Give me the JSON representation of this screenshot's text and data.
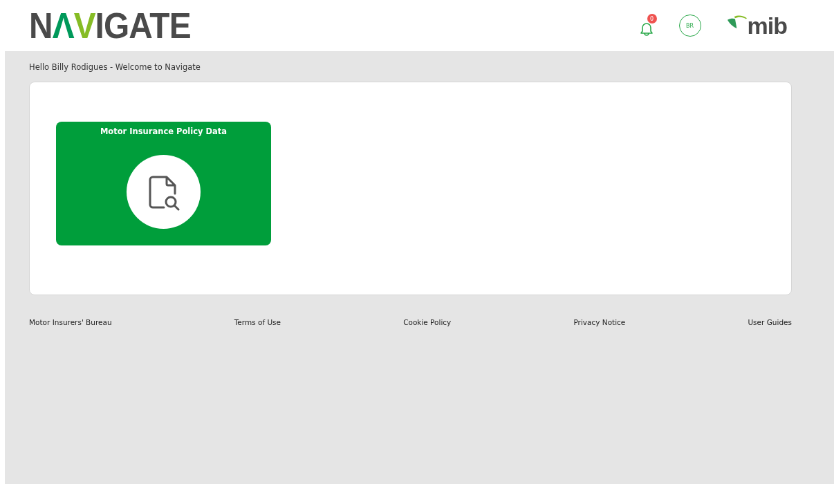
{
  "header": {
    "logo": [
      {
        "text": "N",
        "color": "#4a4a4a"
      },
      {
        "text": "Λ",
        "color": "#00995a"
      },
      {
        "text": "V",
        "color": "#86bc25"
      },
      {
        "text": "IGATE",
        "color": "#4a4a4a"
      }
    ],
    "notifications": {
      "count": "0"
    },
    "avatar": {
      "initials": "BR"
    },
    "brand": {
      "text": "mib"
    }
  },
  "greeting": "Hello Billy Rodigues - Welcome to Navigate",
  "tiles": [
    {
      "title": "Motor Insurance Policy Data"
    }
  ],
  "footer": {
    "links": [
      "Motor Insurers' Bureau",
      "Terms of Use",
      "Cookie Policy",
      "Privacy Notice",
      "User Guides"
    ]
  }
}
